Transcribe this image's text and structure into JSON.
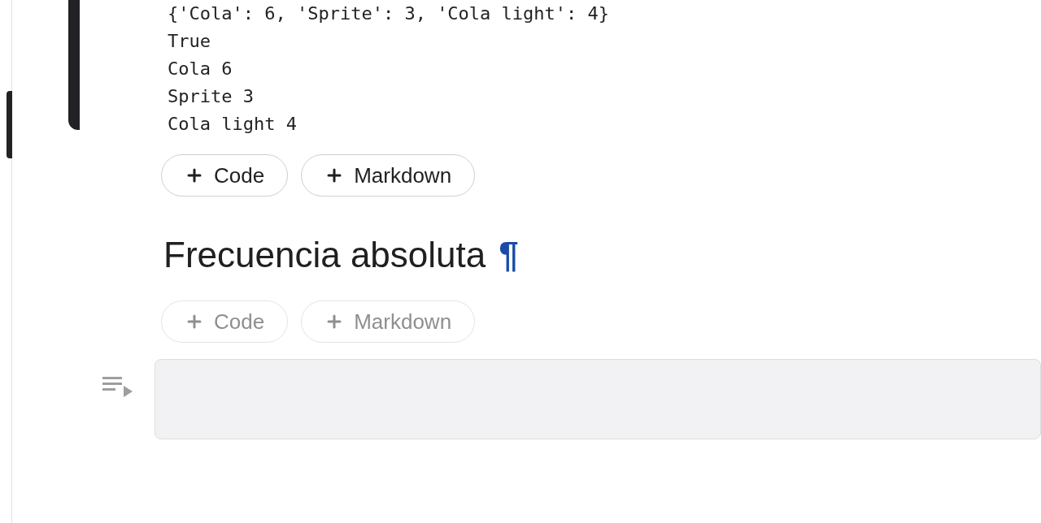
{
  "output_lines": [
    "{'Cola': 6, 'Sprite': 3, 'Cola light': 4}",
    "True",
    "Cola 6",
    "Sprite 3",
    "Cola light 4"
  ],
  "add_buttons_top": {
    "disabled": false,
    "buttons": [
      "Code",
      "Markdown"
    ]
  },
  "heading": {
    "text": "Frecuencia absoluta",
    "anchor": "¶"
  },
  "add_buttons_bottom": {
    "disabled": true,
    "buttons": [
      "Code",
      "Markdown"
    ]
  },
  "empty_cell": {
    "kind": "markdown"
  }
}
